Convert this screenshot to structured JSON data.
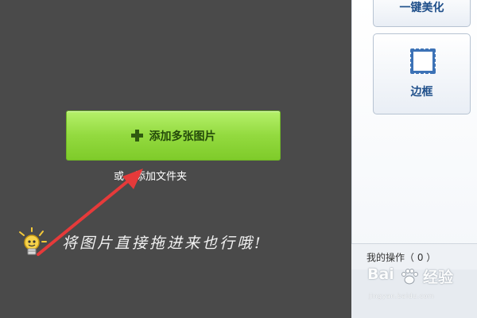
{
  "canvas": {
    "add_photos_label": "添加多张图片",
    "or_text": "或",
    "add_folder_label": "添加文件夹",
    "hint_text": "将图片直接拖进来也行哦!"
  },
  "side_panel": {
    "beautify_label": "一键美化",
    "border_label": "边框",
    "my_operations_label": "我的操作（ 0 ）"
  },
  "watermark": {
    "text_left": "Bai",
    "text_right": "经验",
    "url": "jingyan.baidu.com"
  },
  "colors": {
    "canvas_bg": "#4a4a4a",
    "button_green": "#93da3f",
    "arrow_red": "#e63a3a",
    "panel_label_blue": "#1f4f8a"
  },
  "icons": [
    "plus-icon",
    "lightbulb-icon",
    "frame-icon",
    "red-arrow",
    "paw-icon"
  ]
}
